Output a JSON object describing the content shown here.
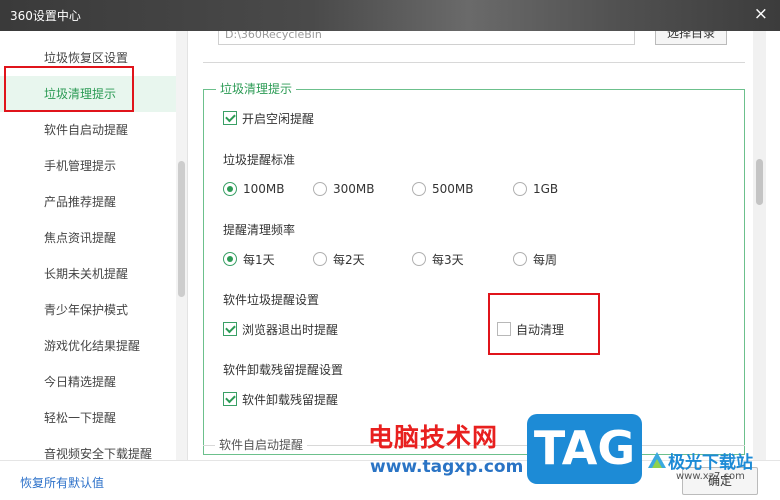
{
  "window": {
    "title": "360设置中心",
    "close_glyph": "×"
  },
  "sidebar": {
    "items": [
      {
        "label": "垃圾恢复区设置",
        "active": false
      },
      {
        "label": "垃圾清理提示",
        "active": true
      },
      {
        "label": "软件自启动提醒",
        "active": false
      },
      {
        "label": "手机管理提示",
        "active": false
      },
      {
        "label": "产品推荐提醒",
        "active": false
      },
      {
        "label": "焦点资讯提醒",
        "active": false
      },
      {
        "label": "长期未关机提醒",
        "active": false
      },
      {
        "label": "青少年保护模式",
        "active": false
      },
      {
        "label": "游戏优化结果提醒",
        "active": false
      },
      {
        "label": "今日精选提醒",
        "active": false
      },
      {
        "label": "轻松一下提醒",
        "active": false
      },
      {
        "label": "音视频安全下载提醒",
        "active": false
      }
    ]
  },
  "recycle": {
    "path": "D:\\360RecycleBin",
    "browse_label": "选择目录"
  },
  "trash_group": {
    "legend": "垃圾清理提示",
    "idle_reminder": {
      "label": "开启空闲提醒",
      "checked": true
    },
    "threshold": {
      "label": "垃圾提醒标准",
      "options": [
        "100MB",
        "300MB",
        "500MB",
        "1GB"
      ],
      "selected": "100MB"
    },
    "frequency": {
      "label": "提醒清理频率",
      "options": [
        "每1天",
        "每2天",
        "每3天",
        "每周"
      ],
      "selected": "每1天"
    },
    "software_trash": {
      "label": "软件垃圾提醒设置",
      "browser_exit": {
        "label": "浏览器退出时提醒",
        "checked": true
      },
      "auto_clean": {
        "label": "自动清理",
        "checked": false
      }
    },
    "uninstall_residue": {
      "label": "软件卸载残留提醒设置",
      "reminder": {
        "label": "软件卸载残留提醒",
        "checked": true
      }
    }
  },
  "next_group": {
    "legend": "软件自启动提醒"
  },
  "footer": {
    "restore_label": "恢复所有默认值",
    "ok_label": "确定"
  },
  "watermark": {
    "site_name": "电脑技术网",
    "site_url": "www.tagxp.com",
    "tag_text": "TAG",
    "logo_text": "极光下载站",
    "logo_url": "www.xz7.com"
  },
  "colors": {
    "accent": "#2c9b55",
    "highlight": "#e0141b",
    "link": "#2b70c9"
  }
}
